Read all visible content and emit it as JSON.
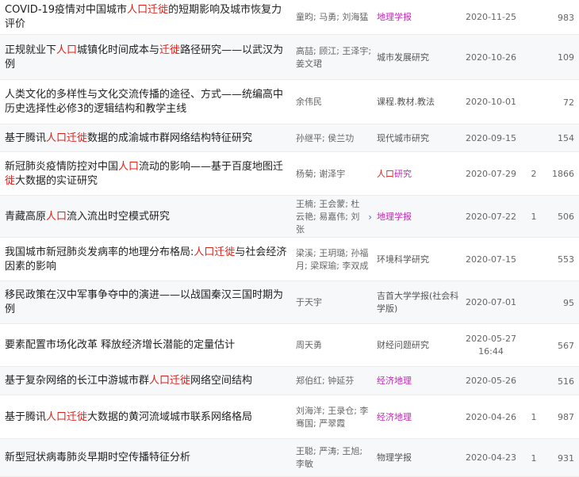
{
  "rows": [
    {
      "title_pre": "COVID-19疫情对中国城市",
      "hl1": "人口迁徙",
      "title_mid": "的短期影响及城市恢复力评价",
      "hl2": "",
      "title_post": "",
      "authors": "童昀; 马勇; 刘海猛",
      "source": "地理学报",
      "date": "2020-11-25",
      "cites": "",
      "downloads": "983"
    },
    {
      "title_pre": "正规就业下",
      "hl1": "人口",
      "title_mid": "城镇化时间成本与",
      "hl2": "迁徙",
      "title_post": "路径研究——以武汉为例",
      "authors": "高喆; 顾江; 王泽宇; 姜文珺",
      "source": "城市发展研究",
      "date": "2020-10-26",
      "cites": "",
      "downloads": "109"
    },
    {
      "title_pre": "人类文化的多样性与文化交流传播的途径、方式——统编高中历史选择性必修3的逻辑结构和教学主线",
      "hl1": "",
      "title_mid": "",
      "hl2": "",
      "title_post": "",
      "authors": "余伟民",
      "source": "课程.教材.教法",
      "date": "2020-10-01",
      "cites": "",
      "downloads": "72"
    },
    {
      "title_pre": "基于腾讯",
      "hl1": "人口迁徙",
      "title_mid": "数据的成渝城市群网络结构特征研究",
      "hl2": "",
      "title_post": "",
      "authors": "孙继平; 侯兰功",
      "source": "现代城市研究",
      "date": "2020-09-15",
      "cites": "",
      "downloads": "154"
    },
    {
      "title_pre": "新冠肺炎疫情防控对中国",
      "hl1": "人口",
      "title_mid": "流动的影响——基于百度地图迁",
      "hl2": "徙",
      "title_post": "大数据的实证研究",
      "authors": "杨菊; 谢泽宇",
      "source_hl": "人口",
      "source": "研究",
      "date": "2020-07-29",
      "cites": "2",
      "downloads": "1866"
    },
    {
      "title_pre": "青藏高原",
      "hl1": "人口",
      "title_mid": "流入流出时空模式研究",
      "hl2": "",
      "title_post": "",
      "authors": "王楠; 王会蒙; 杜云艳; 易嘉伟; 刘张",
      "source": "地理学报",
      "date": "2020-07-22",
      "cites": "1",
      "downloads": "506"
    },
    {
      "title_pre": "我国城市新冠肺炎发病率的地理分布格局:",
      "hl1": "人口迁徙",
      "title_mid": "与社会经济因素的影响",
      "hl2": "",
      "title_post": "",
      "authors": "梁溪; 王玥璐; 孙福月; 梁琛瑜; 李双成",
      "source": "环境科学研究",
      "date": "2020-07-15",
      "cites": "",
      "downloads": "553"
    },
    {
      "title_pre": "移民政策在汉中军事争夺中的演进——以战国秦汉三国时期为例",
      "hl1": "",
      "title_mid": "",
      "hl2": "",
      "title_post": "",
      "authors": "于天宇",
      "source": "吉首大学学报(社会科学版)",
      "date": "2020-07-01",
      "cites": "",
      "downloads": "95"
    },
    {
      "title_pre": "要素配置市场化改革 释放经济增长潜能的定量估计",
      "hl1": "",
      "title_mid": "",
      "hl2": "",
      "title_post": "",
      "authors": "周天勇",
      "source": "财经问题研究",
      "date": "2020-05-27 16:44",
      "cites": "",
      "downloads": "567"
    },
    {
      "title_pre": "基于复杂网络的长江中游城市群",
      "hl1": "人口迁徙",
      "title_mid": "网络空间结构",
      "hl2": "",
      "title_post": "",
      "authors": "郑伯红; 钟延芬",
      "source": "经济地理",
      "date": "2020-05-26",
      "cites": "",
      "downloads": "516"
    },
    {
      "title_pre": "基于腾讯",
      "hl1": "人口迁徙",
      "title_mid": "大数据的黄河流域城市联系网络格局",
      "hl2": "",
      "title_post": "",
      "authors": "刘海洋; 王录仓; 李骞国; 严翠霞",
      "source": "经济地理",
      "date": "2020-04-26",
      "cites": "1",
      "downloads": "987"
    },
    {
      "title_pre": "新型冠状病毒肺炎早期时空传播特征分析",
      "hl1": "",
      "title_mid": "",
      "hl2": "",
      "title_post": "",
      "authors": "王聪; 严涛; 王旭; 李敏",
      "source": "物理学报",
      "date": "2020-04-23",
      "cites": "1",
      "downloads": "931"
    }
  ],
  "more_icon": "chevron-right-icon",
  "colors": {
    "highlight": "#e0201a",
    "pink_source": "#c12bb5"
  }
}
